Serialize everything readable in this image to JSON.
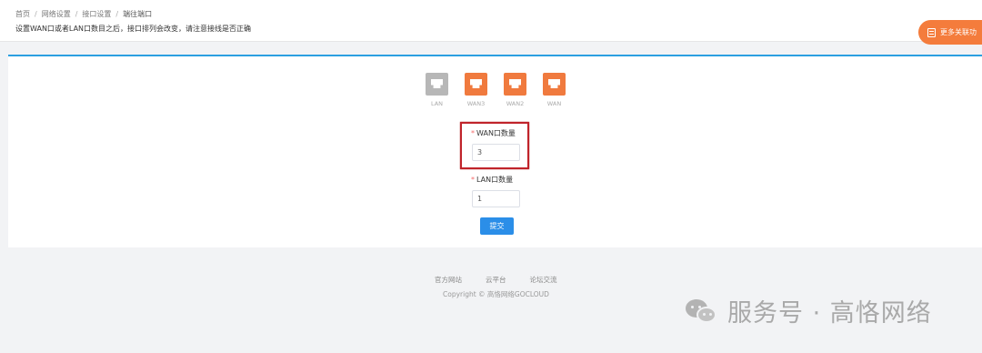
{
  "header": {
    "breadcrumb": [
      "首页",
      "网络设置",
      "接口设置",
      "端往端口"
    ],
    "breadcrumb_sep": "/",
    "hint": "设置WAN口或者LAN口数目之后，接口排列会改变，请注意接线是否正确",
    "more_button": "更多关联功"
  },
  "ports": [
    {
      "label": "LAN",
      "type": "lan",
      "icon": "lan-port-icon"
    },
    {
      "label": "WAN3",
      "type": "wan",
      "icon": "wan-port-icon"
    },
    {
      "label": "WAN2",
      "type": "wan",
      "icon": "wan-port-icon"
    },
    {
      "label": "WAN",
      "type": "wan",
      "icon": "wan-port-icon"
    }
  ],
  "form": {
    "required_mark": "*",
    "wan_label": "WAN口数量",
    "wan_value": "3",
    "lan_label": "LAN口数量",
    "lan_value": "1",
    "submit_label": "提交"
  },
  "footer": {
    "links": [
      "官方网站",
      "云平台",
      "论坛交流"
    ],
    "copyright": "Copyright © 高恪网络GOCLOUD"
  },
  "watermark": {
    "text": "服务号 · 高恪网络"
  },
  "colors": {
    "accent": "#2b9fe0",
    "wan_port": "#f07a3e",
    "lan_port": "#b7b7b7",
    "highlight": "#c0232a",
    "submit": "#2b8ee8",
    "more_button": "#f47c3c"
  }
}
